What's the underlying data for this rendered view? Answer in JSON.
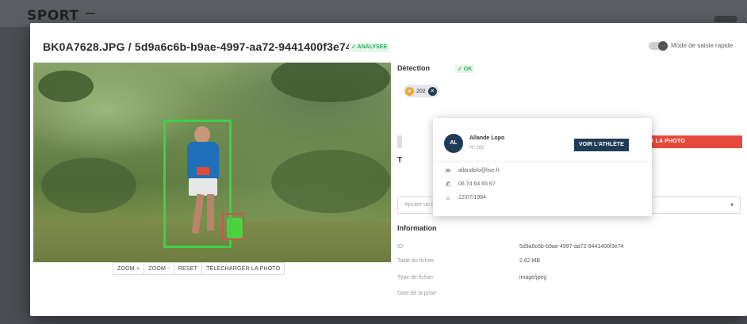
{
  "background": {
    "brand": "SPORT"
  },
  "header": {
    "title": "BK0A7628.JPG / 5d9a6c6b-b9ae-4997-aa72-9441400f3e74",
    "status": "✓ ANALYSÉE",
    "quick_mode_label": "Mode de saisie rapide"
  },
  "photo_tools": [
    "ZOOM +",
    "ZOOM -",
    "RESET",
    "TÉLÉCHARGER LA PHOTO"
  ],
  "detection": {
    "title": "Détection",
    "ok": "✓ OK",
    "chip_label": "202"
  },
  "popover": {
    "avatar_initials": "AL",
    "name": "Allande Lopo",
    "sub": "N° 202",
    "button": "VOIR L'ATHLÈTE",
    "email": "allandelo@live.fr",
    "phone": "06 74 64 65 67",
    "birthdate": "22/07/1984"
  },
  "actions": {
    "delete": "SUPPRIMER LA PHOTO"
  },
  "tags": {
    "section_letter": "T",
    "placeholder": "Ajouter un tag"
  },
  "information": {
    "title": "Information",
    "rows": [
      {
        "key": "ID",
        "value": "5d9a6c6b-b9ae-4997-aa72-9441400f3e74"
      },
      {
        "key": "Taille du fichier",
        "value": "2.62 MB"
      },
      {
        "key": "Type de fichier",
        "value": "image/jpeg"
      },
      {
        "key": "Date de la prise",
        "value": ""
      }
    ]
  },
  "colors": {
    "accent": "#1f3b57",
    "success": "#27ae60",
    "danger": "#e64a3c",
    "bbox": "#3ed04a"
  }
}
